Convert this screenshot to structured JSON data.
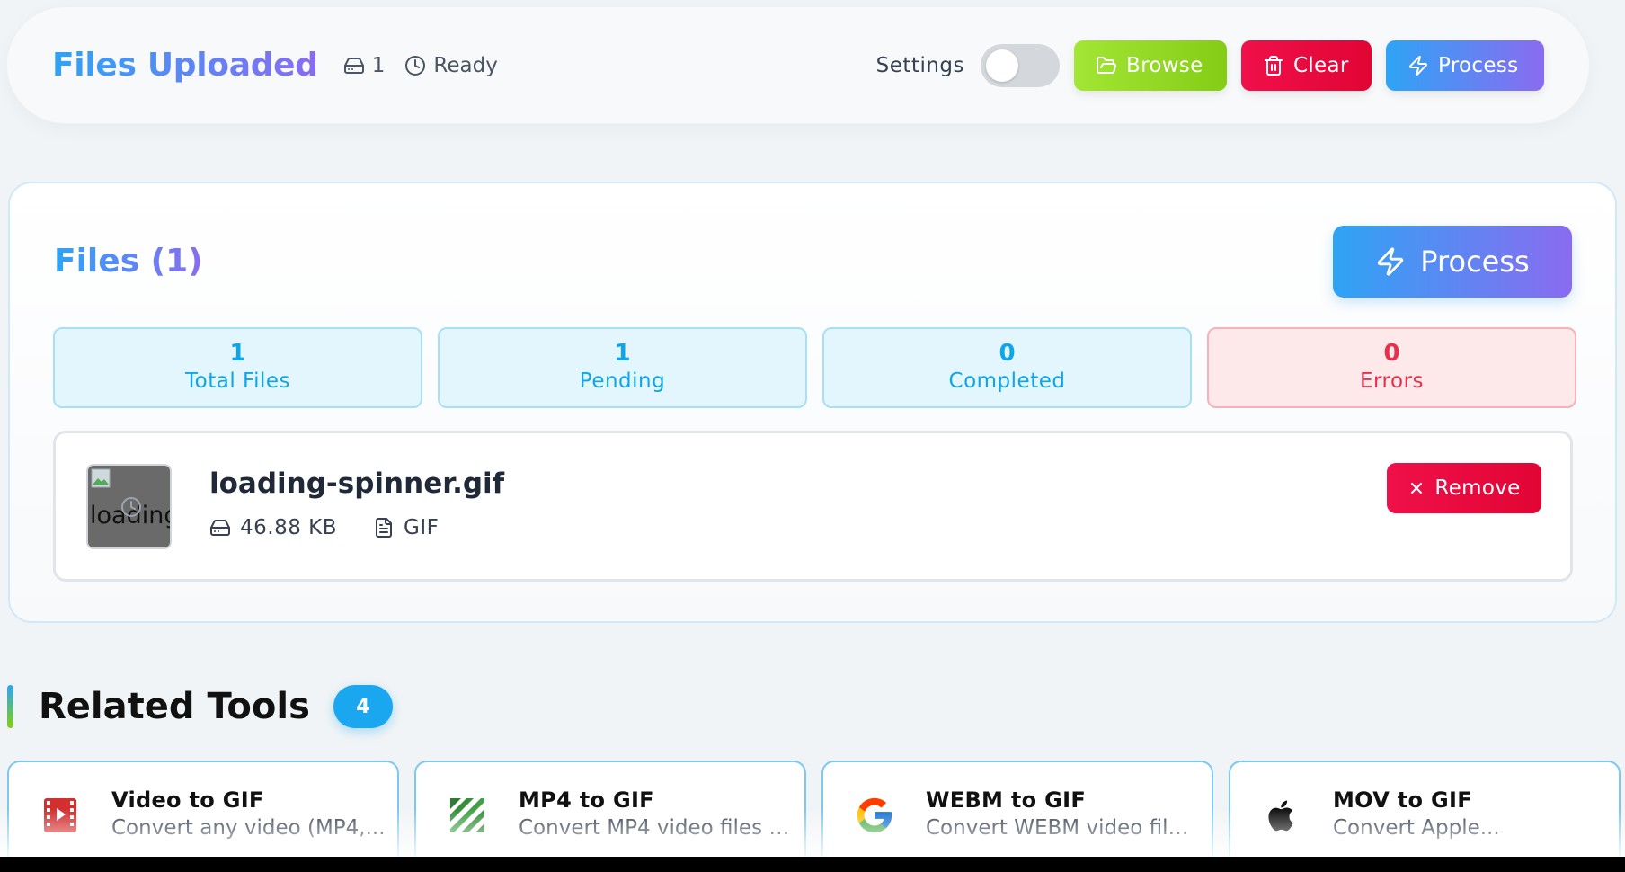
{
  "header": {
    "title": "Files Uploaded",
    "file_count": "1",
    "status": "Ready",
    "settings_label": "Settings",
    "settings_enabled": false,
    "browse_label": "Browse",
    "clear_label": "Clear",
    "process_label": "Process"
  },
  "files_panel": {
    "title": "Files (1)",
    "process_label": "Process",
    "stats": [
      {
        "value": "1",
        "label": "Total Files"
      },
      {
        "value": "1",
        "label": "Pending"
      },
      {
        "value": "0",
        "label": "Completed"
      },
      {
        "value": "0",
        "label": "Errors"
      }
    ],
    "file": {
      "thumbnail_alt": "loading",
      "name": "loading-spinner.gif",
      "size": "46.88 KB",
      "type": "GIF",
      "remove_label": "Remove"
    }
  },
  "related_tools": {
    "title": "Related Tools",
    "count": "4",
    "items": [
      {
        "name": "Video to GIF",
        "description": "Convert any video (MP4,...",
        "icon": "video-film-icon"
      },
      {
        "name": "MP4 to GIF",
        "description": "Convert MP4 video files t...",
        "icon": "ffmpeg-icon"
      },
      {
        "name": "WEBM to GIF",
        "description": "Convert WEBM video files...",
        "icon": "google-icon"
      },
      {
        "name": "MOV to GIF",
        "description": "Convert Apple...",
        "icon": "apple-icon"
      }
    ]
  },
  "colors": {
    "accent_gradient_start": "#2ea4f5",
    "accent_gradient_end": "#8a6bf0",
    "browse": "#84cc16",
    "danger": "#e10534",
    "stat_blue": "#0ea5e9",
    "stat_error": "#e8304d"
  }
}
